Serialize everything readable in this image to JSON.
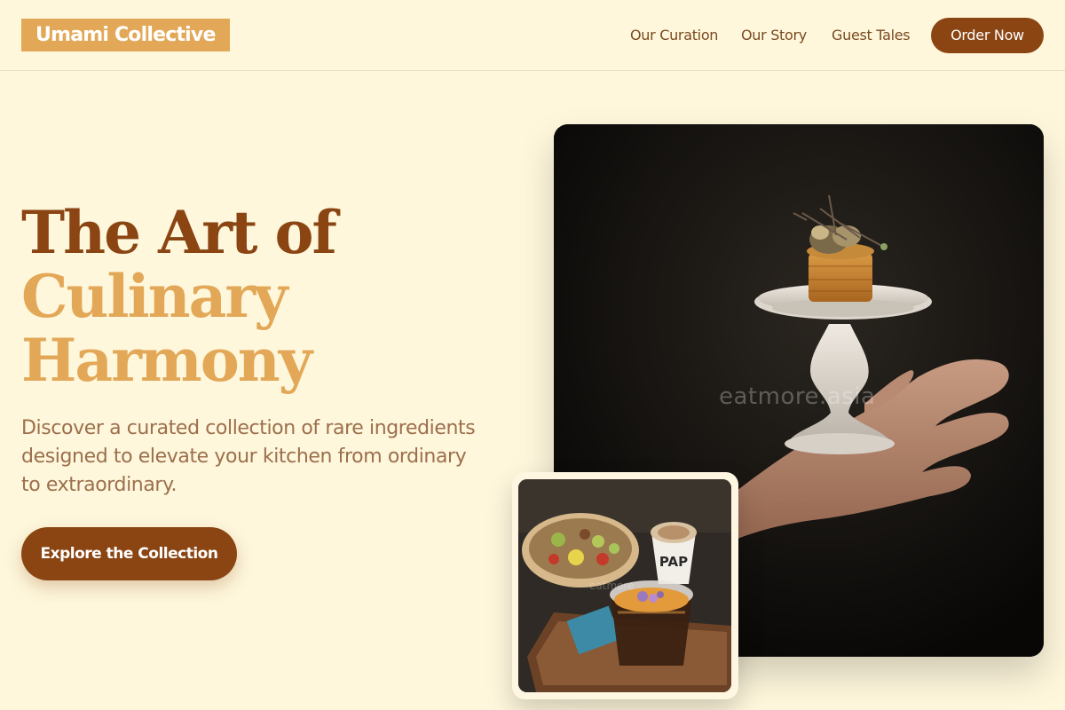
{
  "header": {
    "logo": "Umami Collective",
    "nav": [
      "Our Curation",
      "Our Story",
      "Guest Tales"
    ],
    "cta": "Order Now"
  },
  "hero": {
    "headline_line1": "The Art of",
    "headline_line2": "Culinary",
    "headline_line3": "Harmony",
    "subtext": "Discover a curated collection of rare ingredients designed to elevate your kitchen from ordinary to extraordinary.",
    "button": "Explore the Collection",
    "image_watermark": "eatmore.asia",
    "card_watermark": "eatmore",
    "cup_text": "PAP"
  },
  "colors": {
    "background": "#FEF7DC",
    "brand_dark": "#8B4513",
    "brand_gold": "#E3A857",
    "body_text": "#9C6F4C"
  }
}
